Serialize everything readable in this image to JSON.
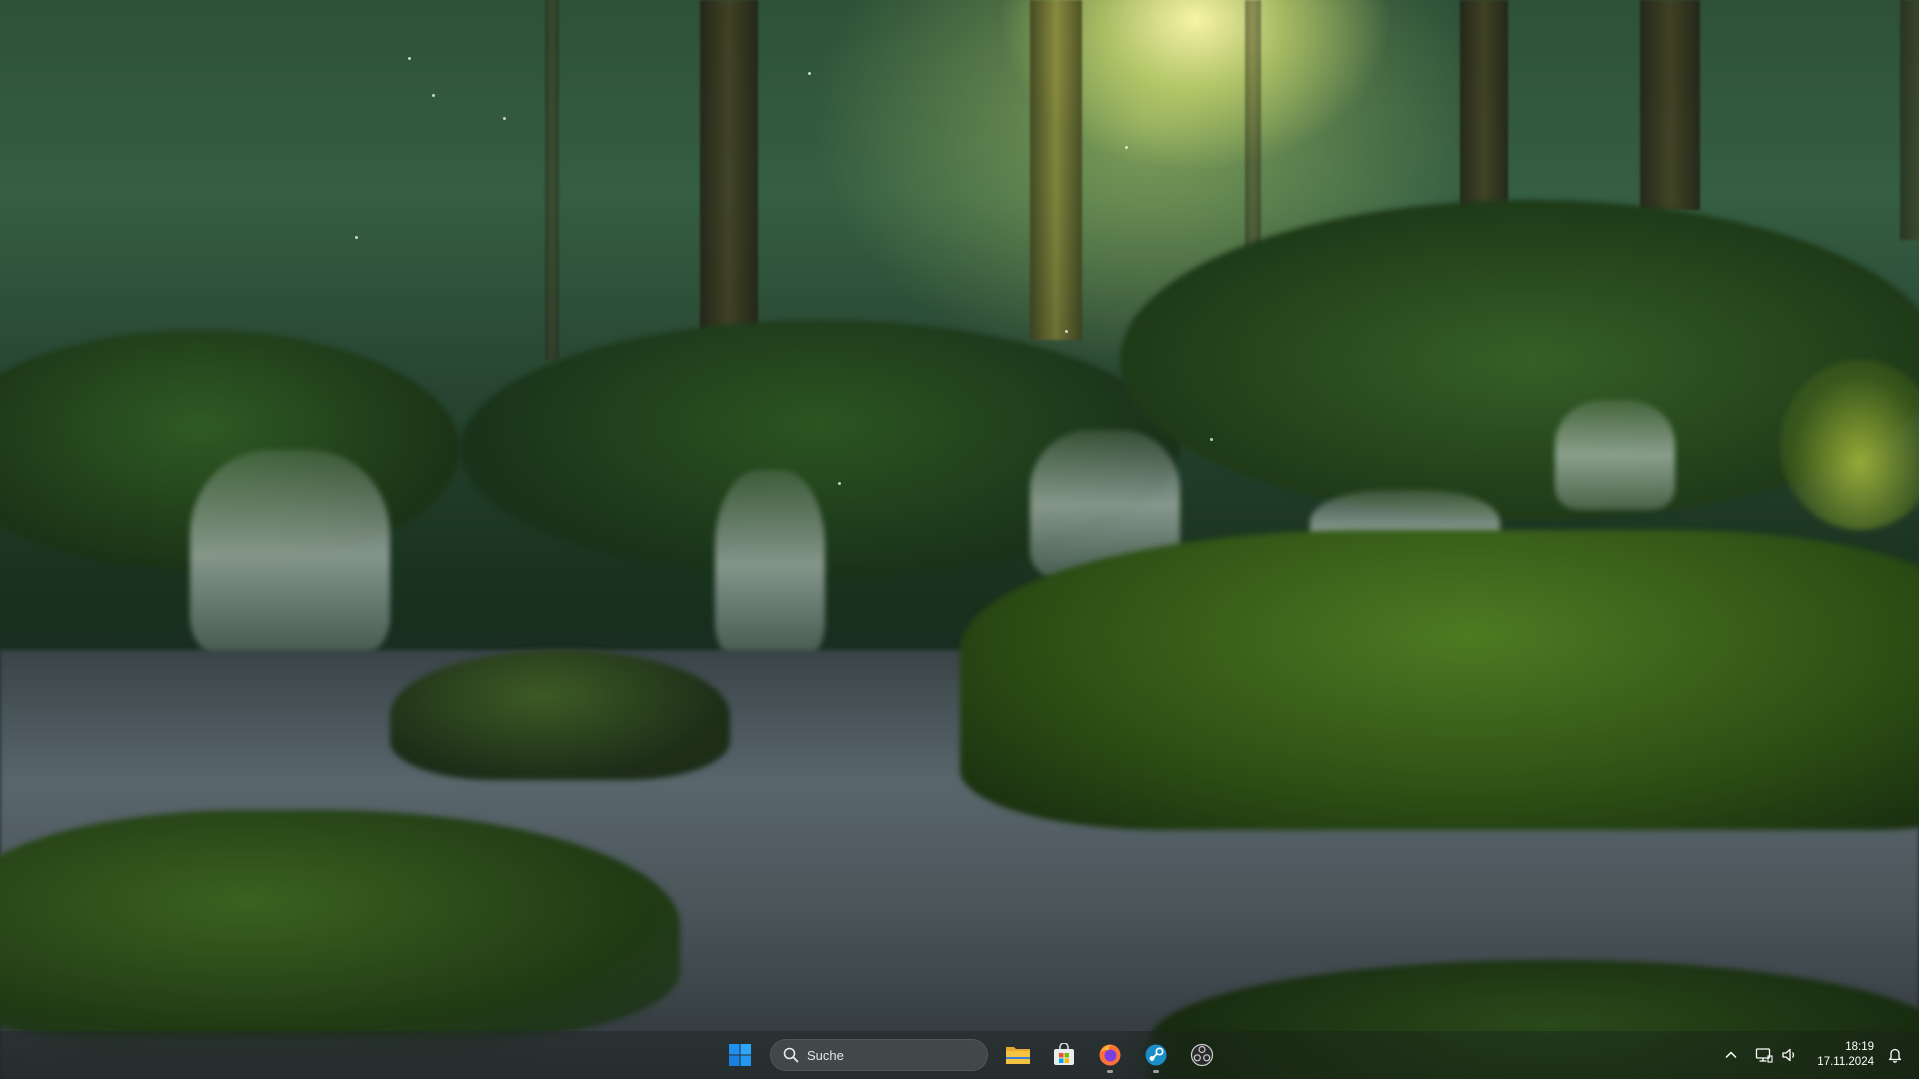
{
  "desktop": {
    "wallpaper": "forest-stream-wallpaper"
  },
  "taskbar": {
    "start_icon": "windows-start-icon",
    "search": {
      "icon": "search-icon",
      "label": "Suche"
    },
    "pinned_apps": [
      {
        "icon": "file-explorer-icon",
        "running": false
      },
      {
        "icon": "microsoft-store-icon",
        "running": false
      },
      {
        "icon": "firefox-icon",
        "running": true
      },
      {
        "icon": "steam-icon",
        "running": true
      },
      {
        "icon": "obs-studio-icon",
        "running": false
      }
    ],
    "tray": {
      "icons": [
        "chevron-up-icon",
        "network-icon",
        "volume-icon"
      ],
      "time": "18:19",
      "date": "17.11.2024",
      "notification_icon": "notification-bell-icon"
    },
    "colors": {
      "windows_blue": "#1f8ff0",
      "explorer_yellow": "#f5c242",
      "firefox_orange": "#ff7139",
      "steam_blue": "#1b8ec9"
    }
  }
}
